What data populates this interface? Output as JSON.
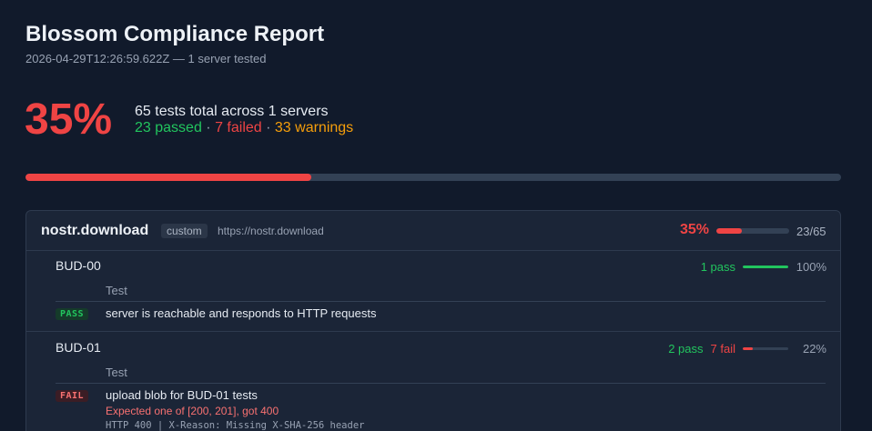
{
  "report": {
    "title": "Blossom Compliance Report",
    "subtitle": "2026-04-29T12:26:59.622Z — 1 server tested"
  },
  "summary": {
    "percent_label": "35%",
    "percent_value": 35,
    "total_line": "65 tests total across 1 servers",
    "passed": "23 passed",
    "failed": "7 failed",
    "warnings": "33 warnings",
    "separator": "·"
  },
  "server": {
    "name": "nostr.download",
    "tag": "custom",
    "url": "https://nostr.download",
    "percent_label": "35%",
    "percent_value": 35,
    "count": "23/65",
    "sections": [
      {
        "title": "BUD-00",
        "pass_label": "1 pass",
        "fail_label": "",
        "percent_label": "100%",
        "percent_value": 100,
        "column_header": "Test",
        "tests": [
          {
            "status": "PASS",
            "name": "server is reachable and responds to HTTP requests"
          }
        ]
      },
      {
        "title": "BUD-01",
        "pass_label": "2 pass",
        "fail_label": "7 fail",
        "percent_label": "22%",
        "percent_value": 22,
        "column_header": "Test",
        "tests": [
          {
            "status": "FAIL",
            "name": "upload blob for BUD-01 tests",
            "error": "Expected one of [200, 201], got 400",
            "detail": "HTTP 400 | X-Reason: Missing X-SHA-256 header"
          }
        ]
      }
    ]
  },
  "colors": {
    "background": "#111a2b",
    "pass": "#22c55e",
    "fail": "#ef4444",
    "warn": "#f59e0b",
    "track": "#334155"
  }
}
